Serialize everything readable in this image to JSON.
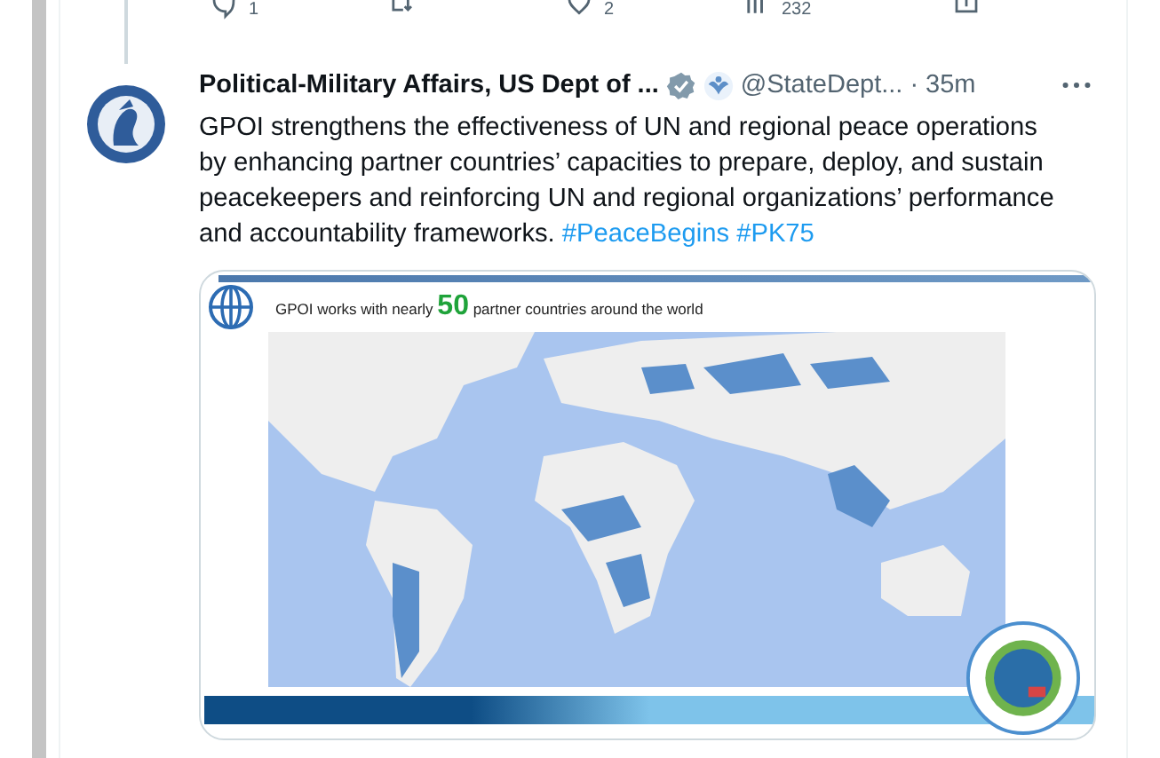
{
  "previous_tweet": {
    "actions": [
      {
        "kind": "reply",
        "count": "1"
      },
      {
        "kind": "retweet"
      },
      {
        "kind": "like",
        "count": "2"
      },
      {
        "kind": "views",
        "count": "232"
      },
      {
        "kind": "share"
      }
    ]
  },
  "tweet": {
    "name": "Political-Military Affairs, US Dept of ...",
    "verified": true,
    "handle": "@StateDept...",
    "time": "· 35m",
    "text": "GPOI strengthens the effectiveness of UN and regional peace operations by enhancing partner countries’ capacities to prepare, deploy, and sustain peacekeepers and reinforcing UN and regional organizations’ performance and accountability frameworks.",
    "hashtags": [
      "#PeaceBegins",
      "#PK75"
    ],
    "media": {
      "kind": "picture",
      "header": {
        "before": "GPOI works with nearly",
        "number": "50",
        "after": "partner countries around the world"
      }
    }
  }
}
